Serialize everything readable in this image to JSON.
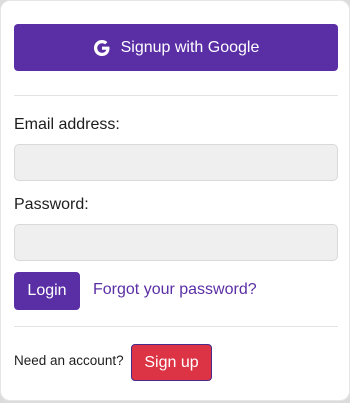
{
  "google_button": {
    "label": "Signup with Google",
    "icon": "google-g-icon"
  },
  "form": {
    "email_label": "Email address:",
    "email_value": "",
    "password_label": "Password:",
    "password_value": ""
  },
  "login_button": {
    "label": "Login"
  },
  "forgot_link": {
    "label": "Forgot your password?"
  },
  "signup_section": {
    "prompt": "Need an account?",
    "button_label": "Sign up"
  },
  "colors": {
    "primary": "#5a2fa5",
    "danger": "#dc3445",
    "input_bg": "#efefef"
  }
}
